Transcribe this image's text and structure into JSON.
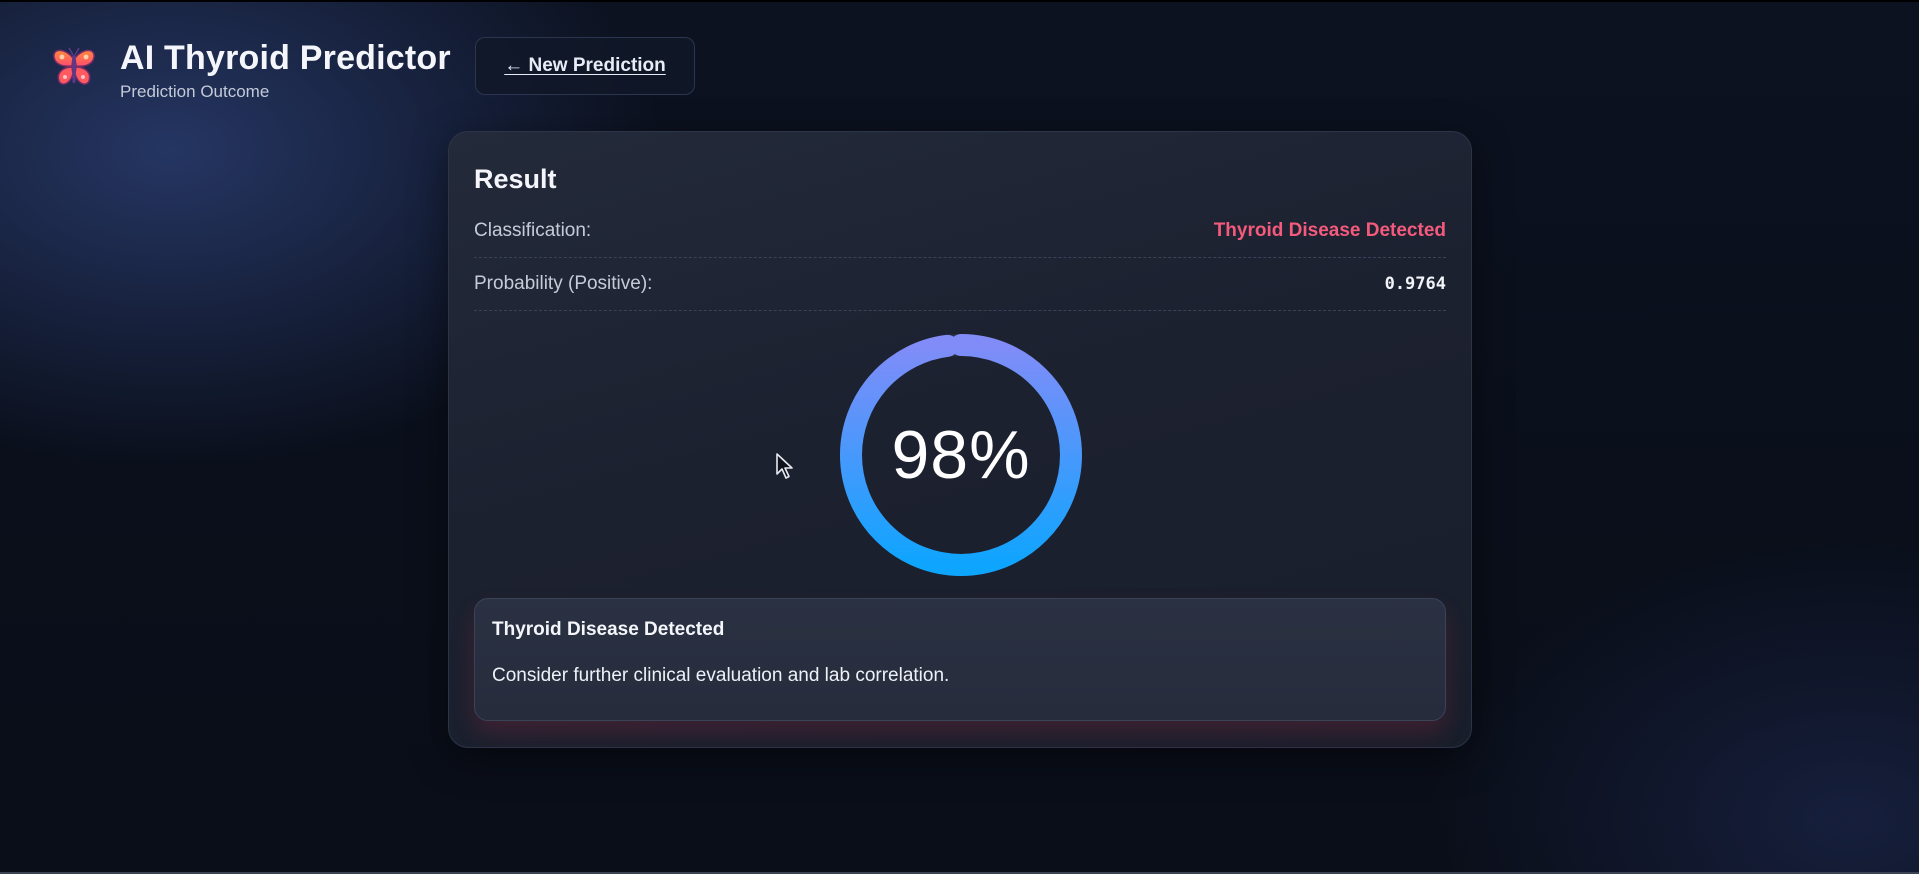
{
  "header": {
    "app_title": "AI Thyroid Predictor",
    "app_subtitle": "Prediction Outcome",
    "logo_icon": "butterfly-icon",
    "new_prediction_label": "← New Prediction"
  },
  "result": {
    "heading": "Result",
    "classification_label": "Classification:",
    "classification_value": "Thyroid Disease Detected",
    "probability_label": "Probability (Positive):",
    "probability_value": "0.9764",
    "gauge_percent_text": "98%",
    "gauge_fraction": 0.98
  },
  "callout": {
    "title": "Thyroid Disease Detected",
    "message": "Consider further clinical evaluation and lab correlation."
  },
  "colors": {
    "danger": "#f35a7c",
    "gauge_start": "#0ea5ff",
    "gauge_end": "#818cf8",
    "background": "#0b101c",
    "card": "#1e2332"
  }
}
